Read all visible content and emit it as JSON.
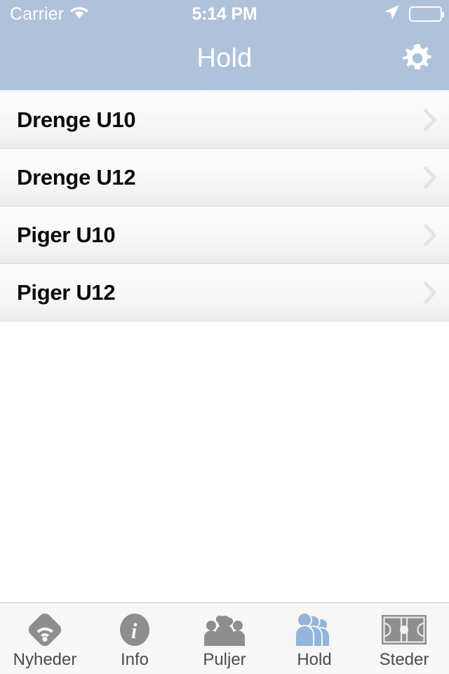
{
  "status_bar": {
    "carrier": "Carrier",
    "wifi_icon": "wifi-icon",
    "time": "5:14 PM",
    "location_icon": "location-arrow-icon",
    "battery_icon": "battery-icon"
  },
  "nav_bar": {
    "title": "Hold",
    "settings_icon": "gear-icon"
  },
  "colors": {
    "nav_background": "#aec2dc",
    "nav_text": "#ffffff",
    "row_text": "#0b0b0b",
    "chevron": "#e4e4e6",
    "tab_background": "#f7f7f7",
    "tab_label": "#4c4c4c",
    "tab_icon_inactive": "#8e8e8e",
    "tab_icon_active": "#93b4db"
  },
  "list": {
    "rows": [
      {
        "label": "Drenge U10",
        "accessory": "chevron-right-icon"
      },
      {
        "label": "Drenge U12",
        "accessory": "chevron-right-icon"
      },
      {
        "label": "Piger U10",
        "accessory": "chevron-right-icon"
      },
      {
        "label": "Piger U12",
        "accessory": "chevron-right-icon"
      }
    ]
  },
  "tab_bar": {
    "selected": "Hold",
    "tabs": [
      {
        "label": "Nyheder",
        "icon": "rss-news-icon",
        "selected": false
      },
      {
        "label": "Info",
        "icon": "info-circle-icon",
        "selected": false
      },
      {
        "label": "Puljer",
        "icon": "group-people-icon",
        "selected": false
      },
      {
        "label": "Hold",
        "icon": "team-people-icon",
        "selected": true
      },
      {
        "label": "Steder",
        "icon": "pitch-field-icon",
        "selected": false
      }
    ]
  }
}
